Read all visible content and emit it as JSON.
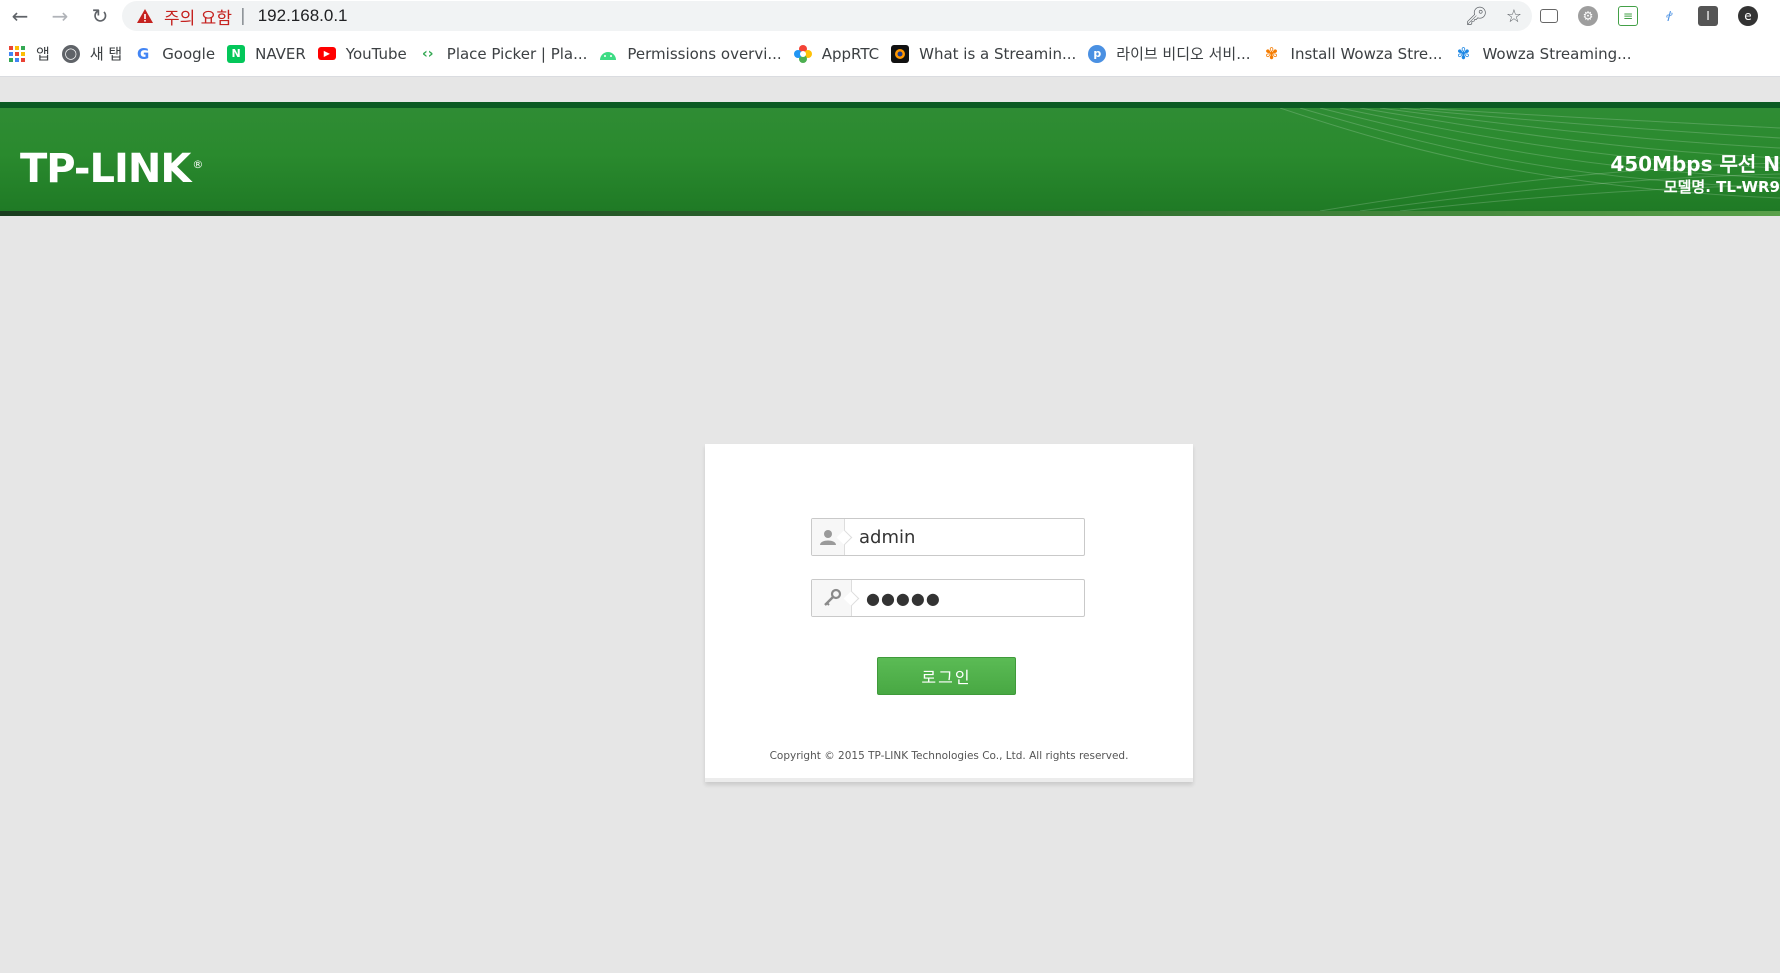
{
  "browser": {
    "back_icon": "back-arrow-icon",
    "forward_icon": "forward-arrow-icon",
    "reload_icon": "reload-icon",
    "security_warning": "주의 요함",
    "separator": "|",
    "url": "192.168.0.1",
    "bookmarks": [
      {
        "label": "앱",
        "icon": "apps-grid-icon"
      },
      {
        "label": "새 탭",
        "icon": "globe-icon"
      },
      {
        "label": "Google",
        "icon": "google-icon"
      },
      {
        "label": "NAVER",
        "icon": "naver-icon"
      },
      {
        "label": "YouTube",
        "icon": "youtube-icon"
      },
      {
        "label": "Place Picker  |  Pla...",
        "icon": "maps-icon"
      },
      {
        "label": "Permissions overvi...",
        "icon": "android-icon"
      },
      {
        "label": "AppRTC",
        "icon": "webrtc-icon"
      },
      {
        "label": "What is a Streamin...",
        "icon": "streaming-icon"
      },
      {
        "label": "라이브 비디오 서비...",
        "icon": "p-circle-icon"
      },
      {
        "label": "Install Wowza Stre...",
        "icon": "wowza-icon"
      },
      {
        "label": "Wowza Streaming...",
        "icon": "wowza-blue-icon"
      }
    ]
  },
  "router": {
    "logo": "TP-LINK",
    "logo_mark": "®",
    "product": "450Mbps 무선 N",
    "model": "모델명. TL-WR9",
    "colors": {
      "banner": "#2a8a2e",
      "button": "#4cae47"
    }
  },
  "login": {
    "username": "admin",
    "password_mask": "●●●●●",
    "user_icon": "user-icon",
    "password_icon": "key-icon",
    "button_label": "로그인",
    "copyright": "Copyright © 2015 TP-LINK Technologies Co., Ltd. All rights reserved."
  }
}
